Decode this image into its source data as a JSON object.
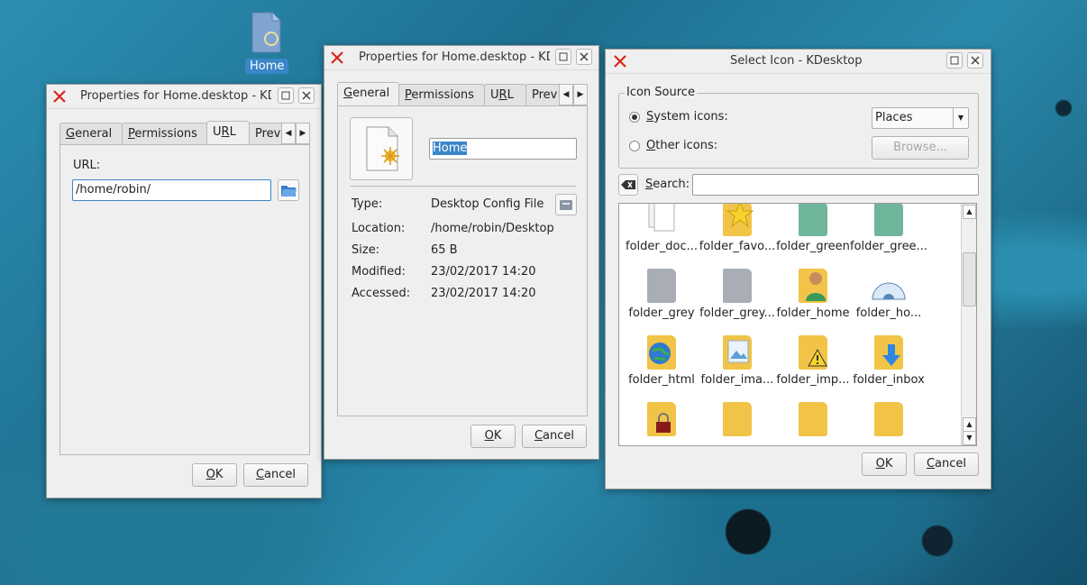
{
  "desktop_icon": {
    "label": "Home"
  },
  "win_url": {
    "title": "Properties for Home.desktop - KDes",
    "tabs": [
      "General",
      "Permissions",
      "URL",
      "Prev"
    ],
    "url_label": "URL:",
    "url_value": "/home/robin/",
    "ok": "OK",
    "cancel": "Cancel"
  },
  "win_general": {
    "title": "Properties for Home.desktop - KDes",
    "tabs": [
      "General",
      "Permissions",
      "URL",
      "Prev"
    ],
    "name_value": "Home",
    "rows": [
      {
        "label": "Type:",
        "value": "Desktop Config File"
      },
      {
        "label": "Location:",
        "value": "/home/robin/Desktop"
      },
      {
        "label": "Size:",
        "value": "65 B"
      },
      {
        "label": "Modified:",
        "value": "23/02/2017 14:20"
      },
      {
        "label": "Accessed:",
        "value": "23/02/2017 14:20"
      }
    ],
    "ok": "OK",
    "cancel": "Cancel"
  },
  "win_icon": {
    "title": "Select Icon - KDesktop",
    "group_title": "Icon Source",
    "system_icons": "System icons:",
    "other_icons": "Other icons:",
    "places_value": "Places",
    "browse": "Browse...",
    "search_label": "Search:",
    "search_value": "",
    "icons": [
      "folder_doc...",
      "folder_favo...",
      "folder_green",
      "folder_gree...",
      "folder_grey",
      "folder_grey...",
      "folder_home",
      "folder_ho...",
      "folder_html",
      "folder_ima...",
      "folder_imp...",
      "folder_inbox"
    ],
    "ok": "OK",
    "cancel": "Cancel"
  },
  "colors": {
    "accent": "#3a86c8",
    "close_red": "#d9261c",
    "folder_yellow": "#f1c447",
    "folder_grey": "#a9aeb6",
    "folder_green": "#6fb59a"
  }
}
